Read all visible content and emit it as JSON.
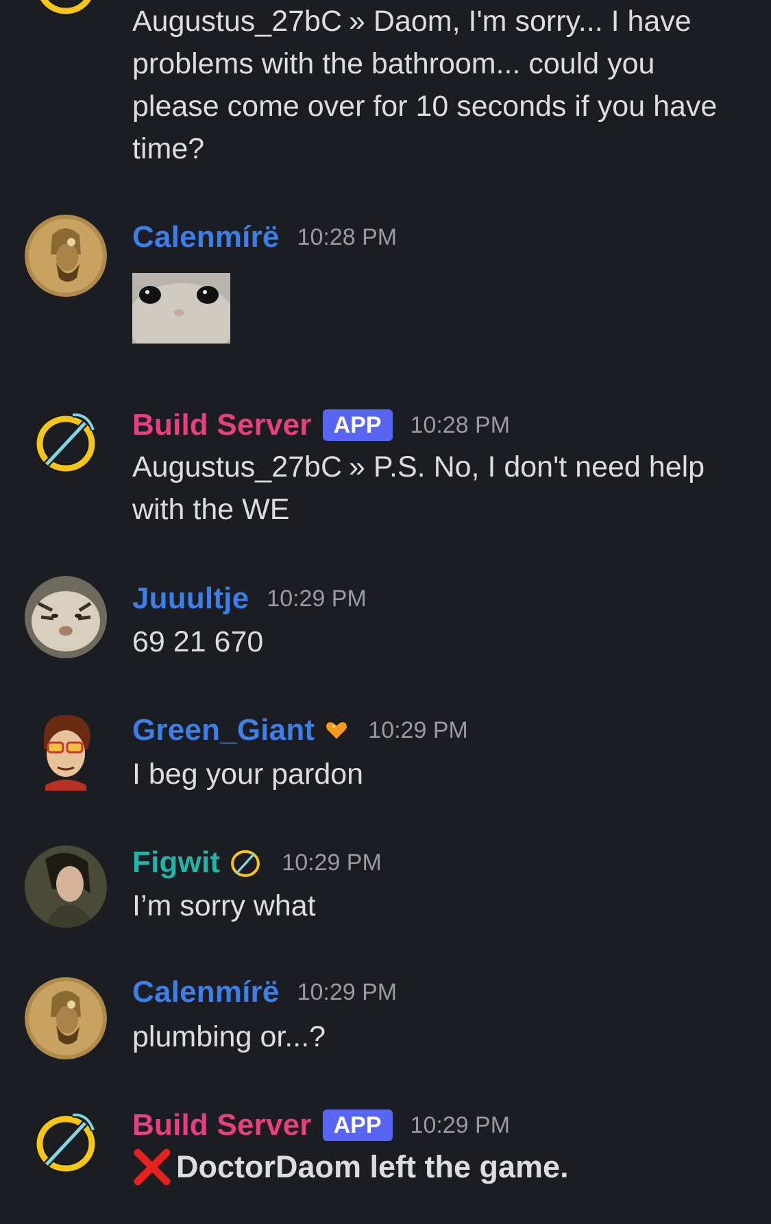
{
  "colors": {
    "background": "#1c1d22",
    "text": "#dcdde1",
    "timestamp": "#9a9ba1",
    "app_badge": "#5865f2",
    "calenmire": "#3d7fe8",
    "build_server": "#e83f7e",
    "juuultje": "#3d7fe8",
    "green_giant": "#3d7fe8",
    "figwit": "#1fb5a8"
  },
  "messages": [
    {
      "id": "m0",
      "body_prefix": "Augustus_27bC",
      "separator": "»",
      "body": "Daom, I'm sorry... I have problems with the bathroom... could you please come over for 10 seconds if you have time?"
    },
    {
      "id": "m1",
      "username": "Calenmírë",
      "timestamp": "10:28 PM",
      "avatar": "coin-portrait-avatar",
      "attachment": "hamster-sticker"
    },
    {
      "id": "m2",
      "username": "Build Server",
      "badge": "APP",
      "timestamp": "10:28 PM",
      "avatar": "pickaxe-logo-avatar",
      "body_prefix": "Augustus_27bC",
      "separator": "»",
      "body": "P.S. No, I don't need help with the WE"
    },
    {
      "id": "m3",
      "username": "Juuultje",
      "timestamp": "10:29 PM",
      "avatar": "tiger-avatar",
      "body": "69 21 670"
    },
    {
      "id": "m4",
      "username": "Green_Giant",
      "timestamp": "10:29 PM",
      "avatar": "cartoon-man-avatar",
      "role_icon": "orange-heart-icon",
      "body": "I beg your pardon"
    },
    {
      "id": "m5",
      "username": "Figwit",
      "timestamp": "10:29 PM",
      "avatar": "elf-portrait-avatar",
      "role_icon": "pickaxe-icon",
      "body": "I’m sorry what"
    },
    {
      "id": "m6",
      "username": "Calenmírë",
      "timestamp": "10:29 PM",
      "avatar": "coin-portrait-avatar",
      "body": "plumbing or...?"
    },
    {
      "id": "m7",
      "username": "Build Server",
      "badge": "APP",
      "timestamp": "10:29 PM",
      "avatar": "pickaxe-logo-avatar",
      "system_icon": "red-x-icon",
      "body": "DoctorDaom left the game."
    }
  ]
}
